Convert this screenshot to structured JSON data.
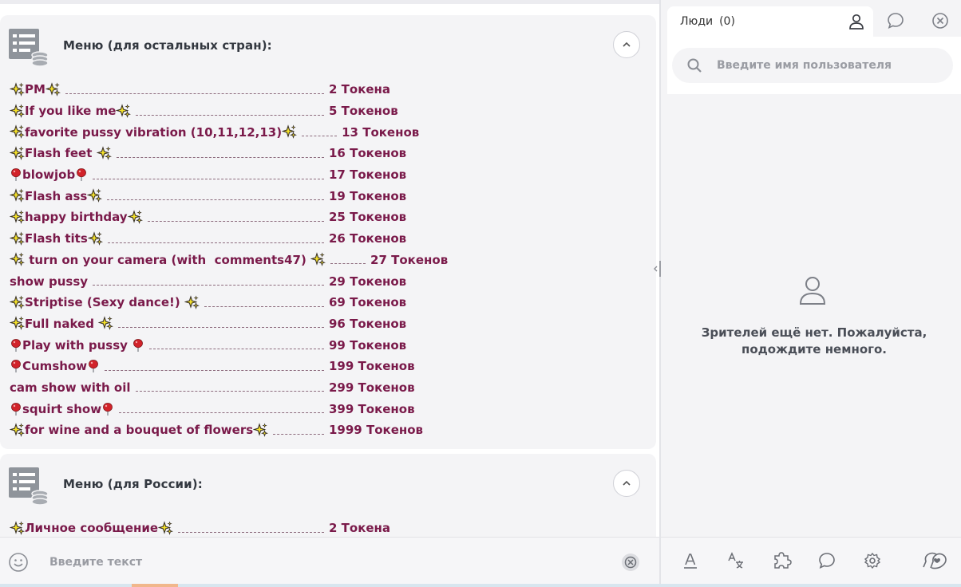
{
  "menus": [
    {
      "title": "Меню (для остальных стран):",
      "items": [
        {
          "label": "PM",
          "pre": "sparkle",
          "post": "sparkle",
          "price": "2 Токена"
        },
        {
          "label": "If you like me",
          "pre": "sparkle",
          "post": "sparkle",
          "price": "5 Токенов"
        },
        {
          "label": "favorite pussy vibration (10,11,12,13)",
          "pre": "sparkle",
          "post": "sparkle",
          "price": "13 Токенов"
        },
        {
          "label": "Flash feet ",
          "pre": "sparkle",
          "post": "sparkle",
          "price": "16 Токенов"
        },
        {
          "label": "blowjob",
          "pre": "pin",
          "post": "pin",
          "price": "17 Токенов"
        },
        {
          "label": "Flash ass",
          "pre": "sparkle",
          "post": "sparkle",
          "price": "19 Токенов"
        },
        {
          "label": "happy birthday",
          "pre": "sparkle",
          "post": "sparkle",
          "price": "25 Токенов"
        },
        {
          "label": "Flash tits",
          "pre": "sparkle",
          "post": "sparkle",
          "price": "26 Токенов"
        },
        {
          "label": " turn on your camera (with  comments47) ",
          "pre": "sparkle",
          "post": "sparkle",
          "price": "27 Токенов"
        },
        {
          "label": "show pussy",
          "pre": "",
          "post": "",
          "price": "29 Токенов"
        },
        {
          "label": "Striptise (Sexy dance!) ",
          "pre": "sparkle",
          "post": "sparkle",
          "price": "69 Токенов"
        },
        {
          "label": "Full naked ",
          "pre": "sparkle",
          "post": "sparkle",
          "price": "96 Токенов"
        },
        {
          "label": "Play with pussy ",
          "pre": "pin",
          "post": "pin",
          "price": "99 Токенов"
        },
        {
          "label": "Cumshow",
          "pre": "pin",
          "post": "pin",
          "price": "199 Токенов"
        },
        {
          "label": "cam show with oil",
          "pre": "",
          "post": "",
          "price": "299 Токенов"
        },
        {
          "label": "squirt show",
          "pre": "pin",
          "post": "pin",
          "price": "399 Токенов"
        },
        {
          "label": "for wine and a bouquet of flowers",
          "pre": "sparkle",
          "post": "sparkle",
          "price": "1999 Токенов"
        }
      ]
    },
    {
      "title": "Меню (для России):",
      "items": [
        {
          "label": "Личное сообщение",
          "pre": "sparkle",
          "post": "sparkle",
          "price": "2 Токена"
        }
      ]
    }
  ],
  "chat_input": {
    "placeholder": "Введите текст"
  },
  "people_panel": {
    "tab_label": "Люди",
    "tab_count": "(0)",
    "search_placeholder": "Введите имя пользователя",
    "empty_text": "Зрителей ещё нет. Пожалуйста, подождите немного."
  },
  "colors": {
    "menu_text": "#7a1a4a",
    "panel_bg": "#f4f4f6",
    "sparkle_fill": "#f4e12a",
    "pin_fill": "#d2232a"
  },
  "icons": {
    "menu_header": "menu-list-coins-icon",
    "collapse": "chevron-up-icon",
    "smile": "smile-icon",
    "send": "send-tip-icon",
    "tab_people": "user-icon",
    "tab_chat": "chat-bubble-icon",
    "tab_close": "close-circle-icon",
    "search": "search-icon",
    "empty": "user-outline-icon",
    "toolbar": [
      "text-format-icon",
      "translate-icon",
      "puzzle-icon",
      "chat-bubble-icon",
      "settings-gear-icon",
      "chat-hearts-icon"
    ]
  }
}
